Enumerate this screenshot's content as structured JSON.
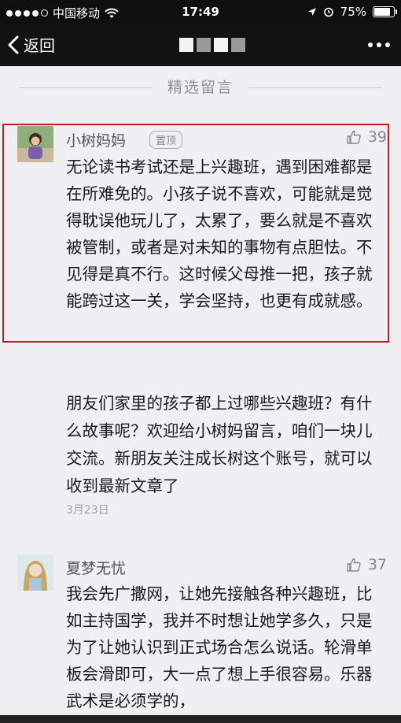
{
  "status_bar": {
    "carrier": "中国移动",
    "time": "17:49",
    "battery": "75%"
  },
  "nav": {
    "back_label": "返回"
  },
  "section": {
    "title": "精选留言"
  },
  "comments": [
    {
      "name": "小树妈妈",
      "badge": "置顶",
      "likes": "39",
      "text": "无论读书考试还是上兴趣班，遇到困难都是在所难免的。小孩子说不喜欢，可能就是觉得耽误他玩儿了，太累了，要么就是不喜欢被管制，或者是对未知的事物有点胆怯。不见得是真不行。这时候父母推一把，孩子就能跨过这一关，学会坚持，也更有成就感。"
    },
    {
      "name": "夏梦无忧",
      "likes": "37",
      "text": "我会先广撒网，让她先接触各种兴趣班，比如主持国学，我并不时想让她学多久，只是为了让她认识到正式场合怎么说话。轮滑单板会滑即可，大一点了想上手很容易。乐器武术是必须学的，"
    }
  ],
  "author_reply": {
    "text": "朋友们家里的孩子都上过哪些兴趣班？有什么故事呢？欢迎给小树妈留言，咱们一块儿交流。新朋友关注成长树这个账号，就可以收到最新文章了",
    "date": "3月23日"
  }
}
